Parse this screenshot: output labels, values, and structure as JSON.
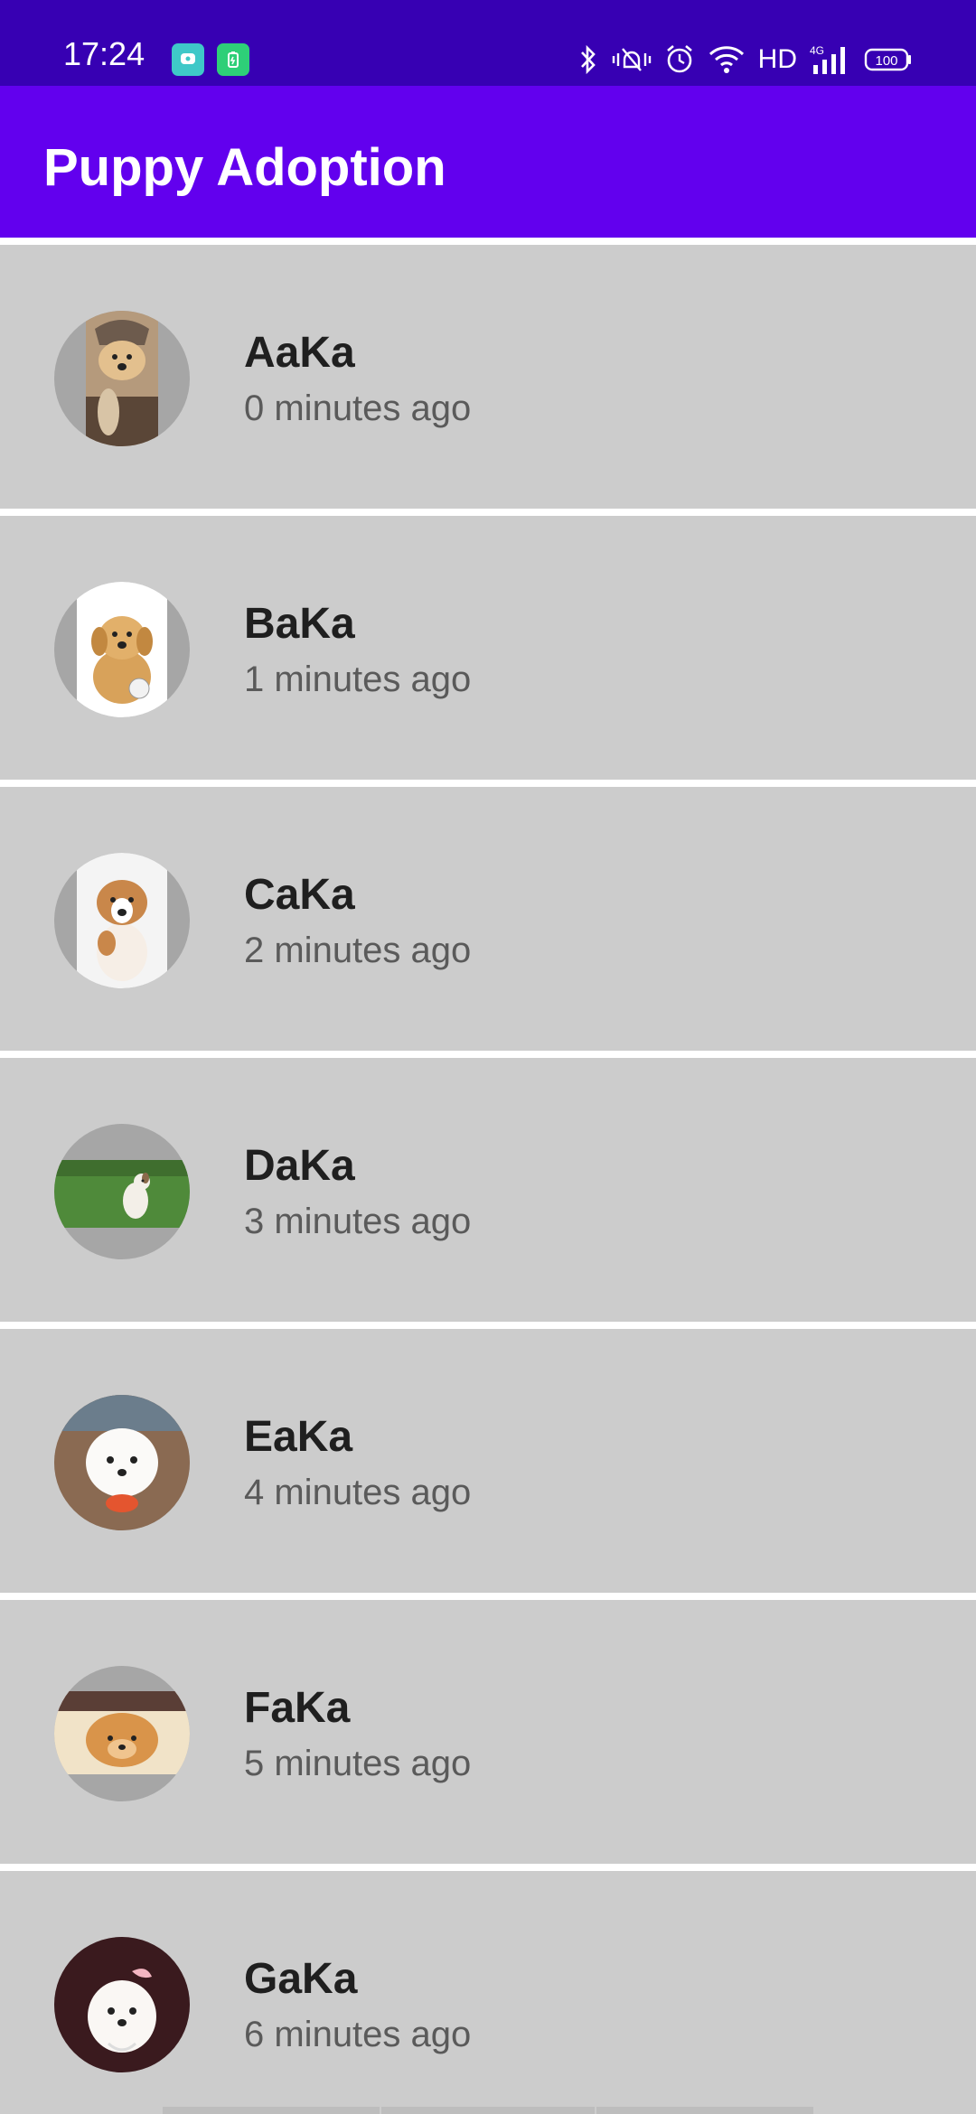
{
  "status_bar": {
    "time": "17:24",
    "network_label": "HD",
    "signal_label": "4G",
    "battery_level": "100",
    "icons": [
      "chat-notification-icon",
      "battery-saver-notification-icon",
      "bluetooth-icon",
      "vibrate-icon",
      "alarm-icon",
      "wifi-icon",
      "signal-icon",
      "battery-icon"
    ]
  },
  "app_bar": {
    "title": "Puppy Adoption"
  },
  "puppies": [
    {
      "name": "AaKa",
      "time": "0 minutes ago"
    },
    {
      "name": "BaKa",
      "time": "1 minutes ago"
    },
    {
      "name": "CaKa",
      "time": "2 minutes ago"
    },
    {
      "name": "DaKa",
      "time": "3 minutes ago"
    },
    {
      "name": "EaKa",
      "time": "4 minutes ago"
    },
    {
      "name": "FaKa",
      "time": "5 minutes ago"
    },
    {
      "name": "GaKa",
      "time": "6 minutes ago"
    }
  ],
  "colors": {
    "status_bar": "#3700b3",
    "app_bar": "#6200ee",
    "item_background": "#cccccc",
    "avatar_placeholder": "#a6a6a6"
  }
}
